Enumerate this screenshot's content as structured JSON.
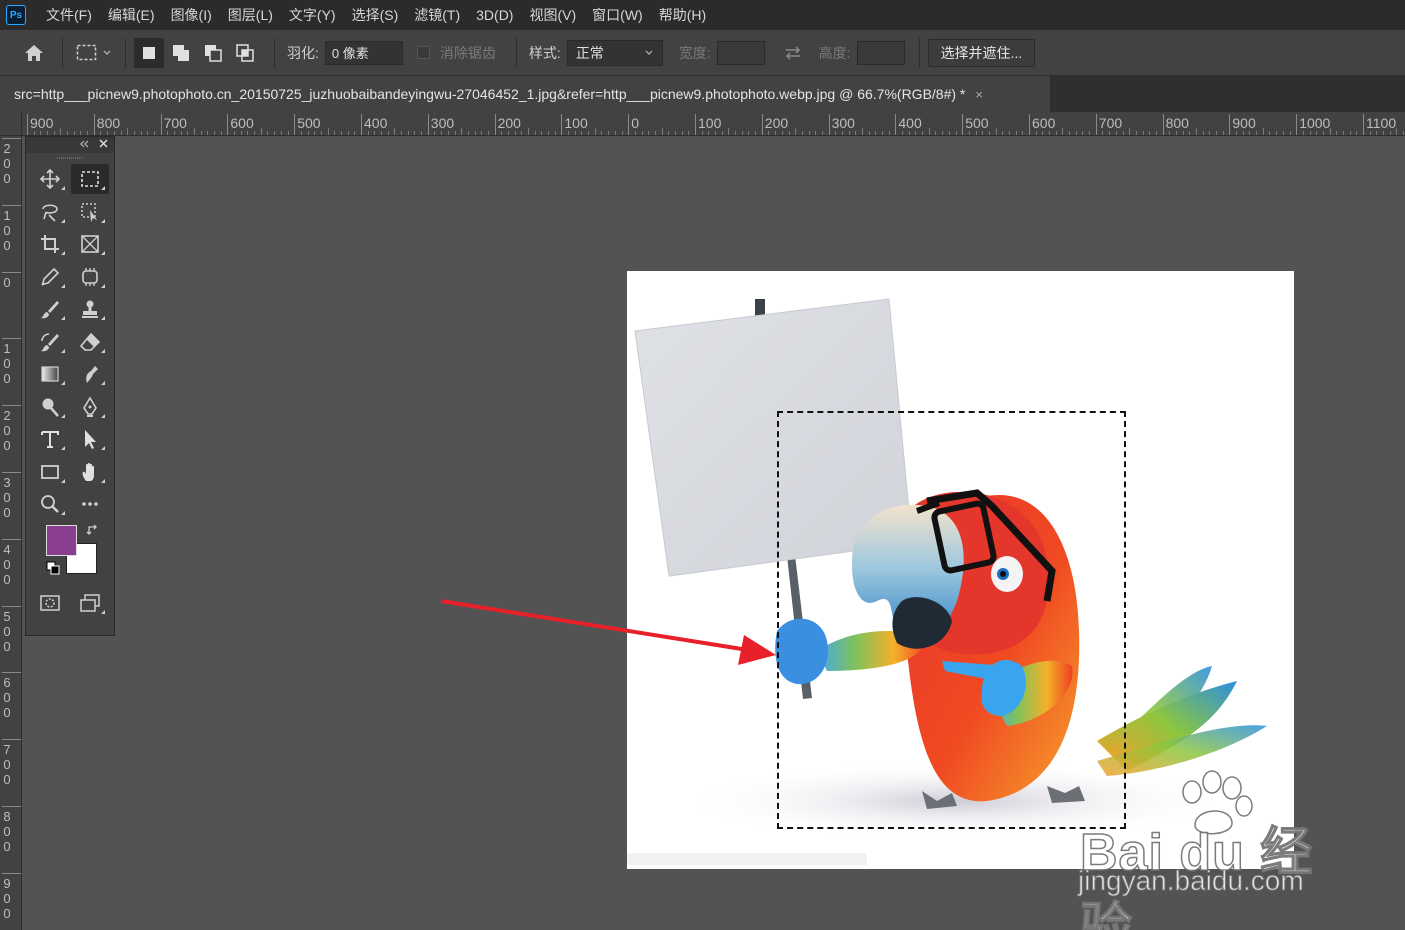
{
  "app": {
    "logo": "Ps"
  },
  "menu": [
    "文件(F)",
    "编辑(E)",
    "图像(I)",
    "图层(L)",
    "文字(Y)",
    "选择(S)",
    "滤镜(T)",
    "3D(D)",
    "视图(V)",
    "窗口(W)",
    "帮助(H)"
  ],
  "options": {
    "feather_label": "羽化:",
    "feather_value": "0 像素",
    "antialias_label": "消除锯齿",
    "style_label": "样式:",
    "style_value": "正常",
    "width_label": "宽度:",
    "height_label": "高度:",
    "select_mask_button": "选择并遮住..."
  },
  "document_tab": {
    "title": "src=http___picnew9.photophoto.cn_20150725_juzhuobaibandeyingwu-27046452_1.jpg&refer=http___picnew9.photophoto.webp.jpg @ 66.7%(RGB/8#) *",
    "close": "×"
  },
  "rulers": {
    "horizontal": [
      "900",
      "800",
      "700",
      "600",
      "500",
      "400",
      "300",
      "200",
      "100",
      "0",
      "100",
      "200",
      "300",
      "400",
      "500",
      "600",
      "700",
      "800",
      "900",
      "1000",
      "1100"
    ],
    "vertical": [
      "200",
      "100",
      "0",
      "100",
      "200",
      "300",
      "400",
      "500",
      "600",
      "700",
      "800",
      "900"
    ]
  },
  "colors": {
    "foreground": "#8a3f8e",
    "background": "#ffffff",
    "arrow": "#e8202a"
  },
  "toolbox": {
    "tools": [
      [
        "move-icon",
        "rect-marquee-icon"
      ],
      [
        "lasso-icon",
        "object-select-icon"
      ],
      [
        "crop-icon",
        "frame-icon"
      ],
      [
        "eyedropper-icon",
        "patch-icon"
      ],
      [
        "brush-icon",
        "stamp-icon"
      ],
      [
        "history-brush-icon",
        "eraser-icon"
      ],
      [
        "gradient-icon",
        "smudge-icon"
      ],
      [
        "dodge-icon",
        "pen-icon"
      ],
      [
        "type-icon",
        "path-select-icon"
      ],
      [
        "rectangle-icon",
        "hand-icon"
      ],
      [
        "zoom-icon",
        "more-icon"
      ]
    ]
  },
  "watermark": {
    "line1": "Bai du 经验",
    "line2": "jingyan.baidu.com"
  }
}
